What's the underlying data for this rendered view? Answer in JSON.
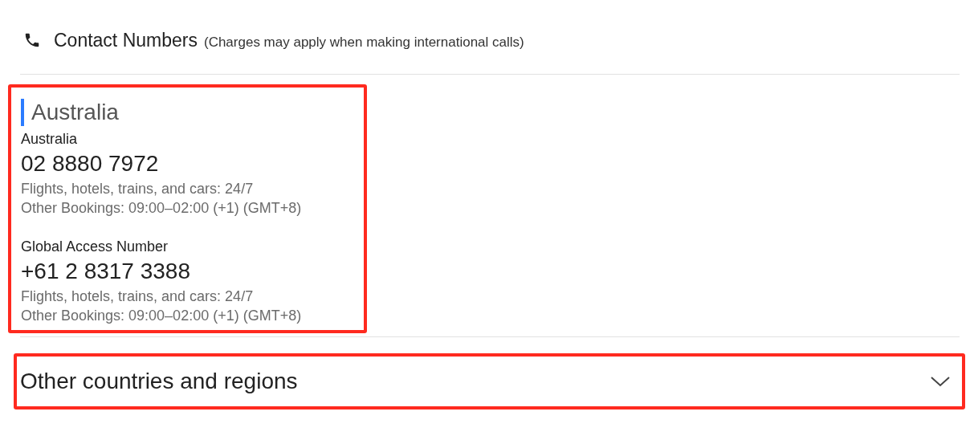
{
  "header": {
    "title": "Contact Numbers",
    "note": "(Charges may apply when making international calls)"
  },
  "region": {
    "title": "Australia",
    "entries": [
      {
        "label": "Australia",
        "number": "02 8880 7972",
        "hours": [
          "Flights, hotels, trains, and cars: 24/7",
          "Other Bookings: 09:00–02:00 (+1) (GMT+8)"
        ]
      },
      {
        "label": "Global Access Number",
        "number": "+61 2 8317 3388",
        "hours": [
          "Flights, hotels, trains, and cars: 24/7",
          "Other Bookings: 09:00–02:00 (+1) (GMT+8)"
        ]
      }
    ]
  },
  "other": {
    "label": "Other countries and regions",
    "expanded": false
  }
}
